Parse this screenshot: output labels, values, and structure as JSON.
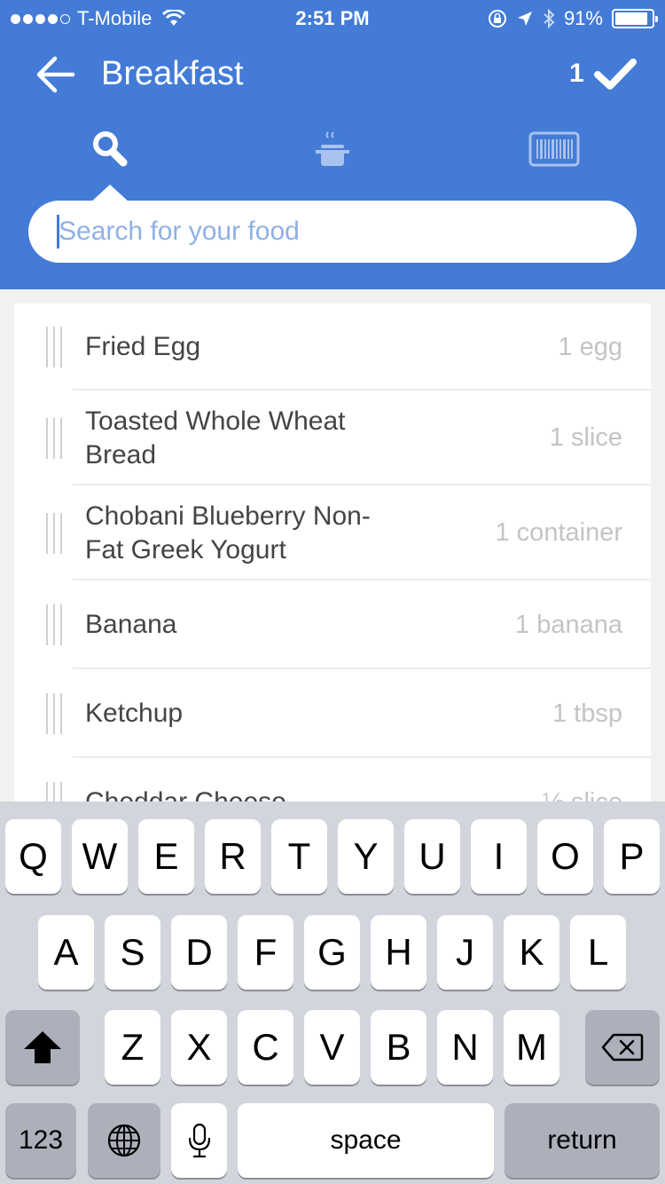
{
  "status_bar": {
    "carrier": "T-Mobile",
    "time": "2:51 PM",
    "battery": "91%",
    "battery_level": 0.91
  },
  "header": {
    "title": "Breakfast",
    "selected_count": "1"
  },
  "tabs": [
    "search",
    "recipes",
    "barcode"
  ],
  "search": {
    "placeholder": "Search for your food"
  },
  "foods": [
    {
      "name": "Fried Egg",
      "amount": "1 egg"
    },
    {
      "name": "Toasted Whole Wheat Bread",
      "amount": "1 slice"
    },
    {
      "name": "Chobani Blueberry Non-Fat Greek Yogurt",
      "amount": "1 container"
    },
    {
      "name": "Banana",
      "amount": "1 banana"
    },
    {
      "name": "Ketchup",
      "amount": "1 tbsp"
    },
    {
      "name": "Cheddar Cheese",
      "amount": "½ slice"
    }
  ],
  "keyboard": {
    "row1": [
      "Q",
      "W",
      "E",
      "R",
      "T",
      "Y",
      "U",
      "I",
      "O",
      "P"
    ],
    "row2": [
      "A",
      "S",
      "D",
      "F",
      "G",
      "H",
      "J",
      "K",
      "L"
    ],
    "row3": [
      "Z",
      "X",
      "C",
      "V",
      "B",
      "N",
      "M"
    ],
    "numbers": "123",
    "space": "space",
    "return": "return"
  },
  "colors": {
    "header_blue": "#437bd6",
    "placeholder": "#8fb0e6",
    "keyboard_bg": "#d2d5db"
  }
}
